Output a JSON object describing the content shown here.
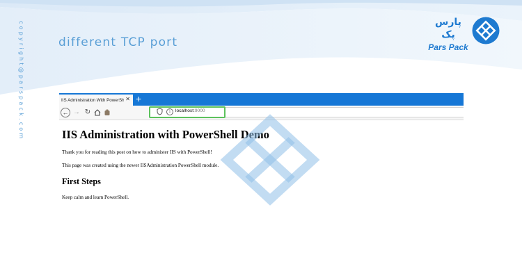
{
  "slide": {
    "title": "different TCP port",
    "copyright": "copyright@parspack.com"
  },
  "brand": {
    "name_fa": "پارس پک",
    "name_en": "Pars Pack",
    "icon": "parspack-diamond-logo",
    "color": "#1e7ad0"
  },
  "browser": {
    "tab_title": "IIS Administration With PowerShell",
    "tab_close": "✕",
    "new_tab": "+",
    "url_host": "localhost",
    "url_port": ":9000",
    "accent": "#1677d6",
    "highlight_color": "#5cc25c",
    "icons": {
      "back": "arrow-left-icon",
      "forward": "arrow-right-icon",
      "reload": "reload-icon",
      "home": "home-icon",
      "extension": "extension-icon",
      "shield": "shield-icon",
      "info": "info-icon"
    }
  },
  "page": {
    "heading": "IIS Administration with PowerShell Demo",
    "paragraph1": "Thank you for reading this post on how to administer IIS with PowerShell!",
    "paragraph2": "This page was created using the newer IISAdministration PowerShell module.",
    "subheading": "First Steps",
    "paragraph3": "Keep calm and learn PowerShell."
  }
}
